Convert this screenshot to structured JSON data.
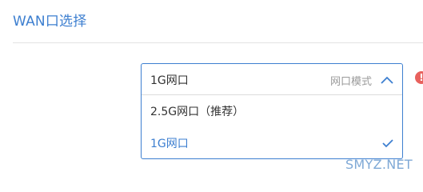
{
  "section": {
    "title": "WAN口选择"
  },
  "wan_select": {
    "value": "1G网口",
    "mode_label": "网口模式",
    "expanded": true,
    "options": [
      {
        "label": "2.5G网口（推荐）",
        "selected": false
      },
      {
        "label": "1G网口",
        "selected": true
      }
    ]
  },
  "alert": {
    "glyph": "!"
  },
  "watermark": {
    "text": "SMYZ.NET"
  },
  "colors": {
    "accent": "#3d7fd0",
    "alert": "#e8615d"
  }
}
